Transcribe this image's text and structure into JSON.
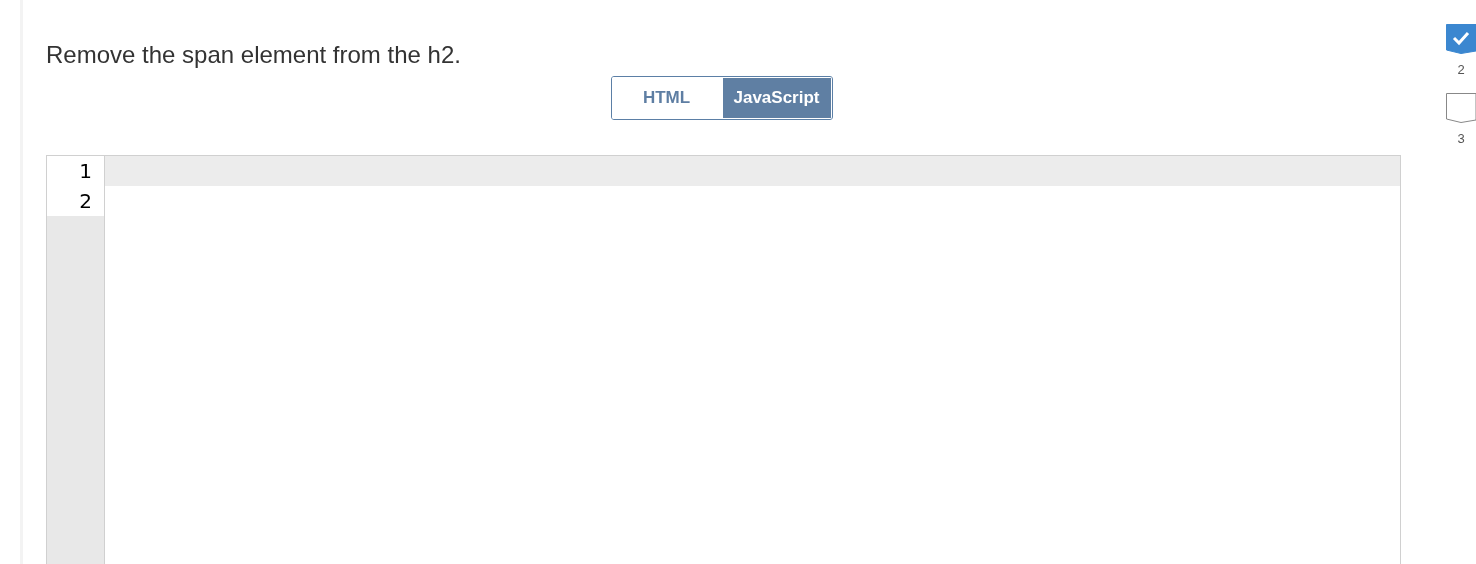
{
  "instruction": "Remove the span element from the h2.",
  "tabs": [
    {
      "label": "HTML",
      "selected": false
    },
    {
      "label": "JavaScript",
      "selected": true
    }
  ],
  "editor": {
    "current_line_highlighted": true,
    "lines": [
      {
        "number": "1"
      },
      {
        "number": "2"
      }
    ]
  },
  "steps": [
    {
      "number": "2",
      "done": true
    },
    {
      "number": "3",
      "done": false
    }
  ]
}
